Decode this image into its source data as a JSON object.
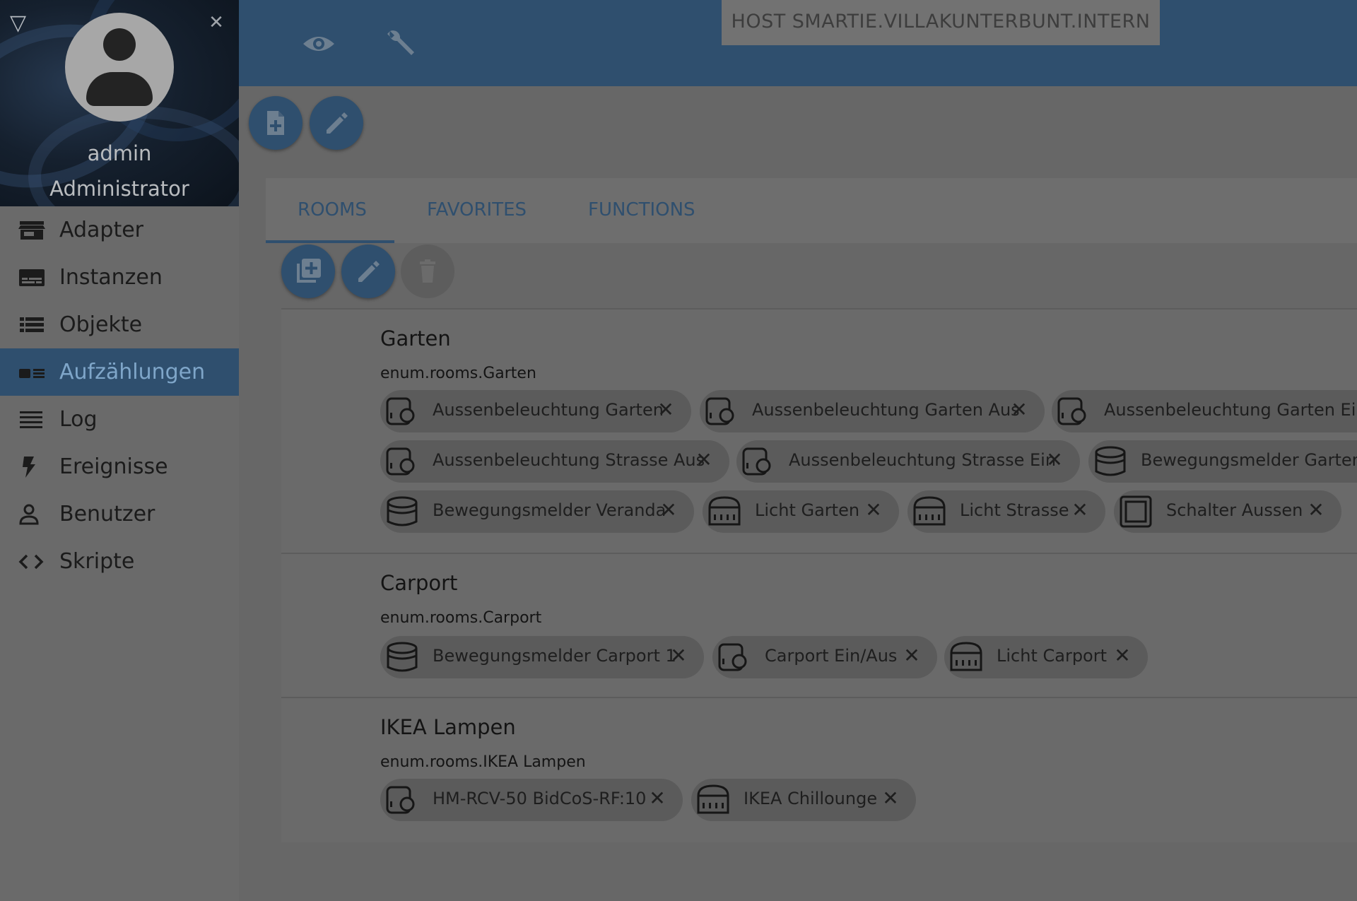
{
  "sidebar": {
    "user": {
      "name": "admin",
      "role": "Administrator"
    },
    "items": [
      {
        "label": "Adapter",
        "icon": "store-icon"
      },
      {
        "label": "Instanzen",
        "icon": "instances-icon"
      },
      {
        "label": "Objekte",
        "icon": "list-icon"
      },
      {
        "label": "Aufzählungen",
        "icon": "enum-icon",
        "active": true
      },
      {
        "label": "Log",
        "icon": "log-icon"
      },
      {
        "label": "Ereignisse",
        "icon": "flash-icon"
      },
      {
        "label": "Benutzer",
        "icon": "person-icon"
      },
      {
        "label": "Skripte",
        "icon": "code-icon"
      }
    ]
  },
  "header": {
    "host": "HOST SMARTIE.VILLAKUNTERBUNT.INTERN",
    "buttons": [
      "eye-icon",
      "wrench-icon"
    ]
  },
  "tabs": [
    {
      "label": "ROOMS",
      "active": true
    },
    {
      "label": "FAVORITES"
    },
    {
      "label": "FUNCTIONS"
    }
  ],
  "sections": [
    {
      "title": "Garten",
      "id": "enum.rooms.Garten",
      "members": [
        {
          "label": "Aussenbeleuchtung Garten",
          "icon": "actuator-icon"
        },
        {
          "label": "Aussenbeleuchtung Garten Aus",
          "icon": "actuator-icon"
        },
        {
          "label": "Aussenbeleuchtung Garten Ein",
          "icon": "actuator-icon"
        },
        {
          "label": "Aussenbeleuchtung Strasse Aus",
          "icon": "actuator-icon"
        },
        {
          "label": "Aussenbeleuchtung Strasse Ein",
          "icon": "actuator-icon"
        },
        {
          "label": "Bewegungsmelder Gartenh",
          "icon": "motion-sensor-icon"
        },
        {
          "label": "Bewegungsmelder Veranda",
          "icon": "motion-sensor-icon"
        },
        {
          "label": "Licht Garten",
          "icon": "dimmer-icon"
        },
        {
          "label": "Licht Strasse",
          "icon": "dimmer-icon"
        },
        {
          "label": "Schalter Aussen",
          "icon": "switch-icon"
        }
      ]
    },
    {
      "title": "Carport",
      "id": "enum.rooms.Carport",
      "members": [
        {
          "label": "Bewegungsmelder Carport 1",
          "icon": "motion-sensor-icon"
        },
        {
          "label": "Carport Ein/Aus",
          "icon": "actuator-icon"
        },
        {
          "label": "Licht Carport",
          "icon": "dimmer-icon"
        }
      ]
    },
    {
      "title": "IKEA Lampen",
      "id": "enum.rooms.IKEA Lampen",
      "members": [
        {
          "label": "HM-RCV-50 BidCoS-RF:10",
          "icon": "actuator-icon"
        },
        {
          "label": "IKEA Chillounge",
          "icon": "dimmer-icon"
        }
      ]
    }
  ],
  "colors": {
    "primary": "#2f4f6e",
    "overlay_background": "#676767",
    "active_text": "#7fa6c9"
  }
}
